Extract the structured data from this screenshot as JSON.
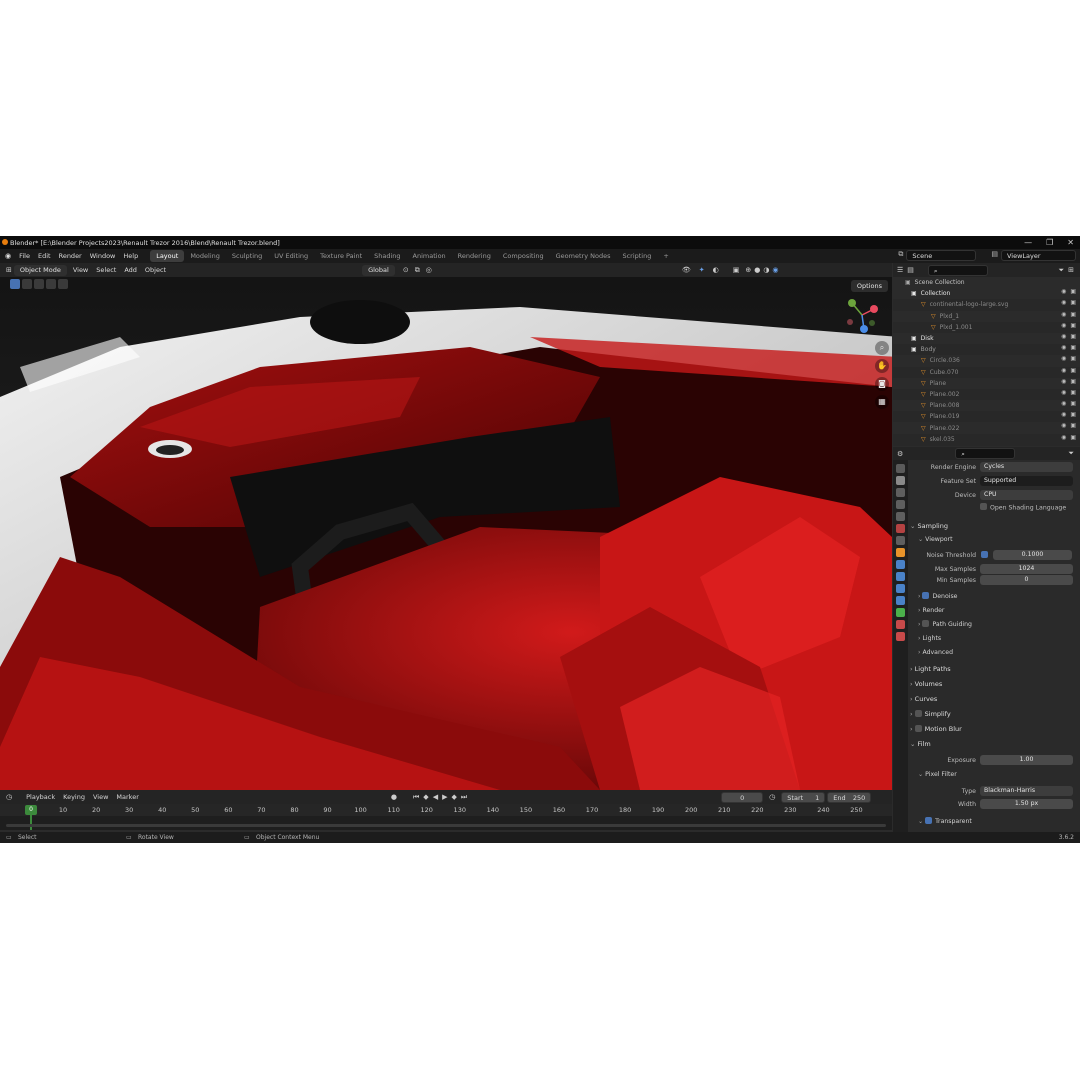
{
  "window": {
    "title": "Blender* [E:\\Blender Projects2023\\Renault Trezor 2016\\Blend\\Renault Trezor.blend]",
    "controls": [
      "—",
      "❐",
      "✕"
    ]
  },
  "menubar": {
    "menus": [
      "File",
      "Edit",
      "Render",
      "Window",
      "Help"
    ],
    "workspaces": [
      "Layout",
      "Modeling",
      "Sculpting",
      "UV Editing",
      "Texture Paint",
      "Shading",
      "Animation",
      "Rendering",
      "Compositing",
      "Geometry Nodes",
      "Scripting"
    ],
    "add_workspace": "+",
    "scene": "Scene",
    "view_layer": "ViewLayer"
  },
  "viewport_header": {
    "mode": "Object Mode",
    "menus": [
      "View",
      "Select",
      "Add",
      "Object"
    ],
    "orientation": "Global",
    "options": "Options"
  },
  "outliner": {
    "root": "Scene Collection",
    "rows": [
      {
        "name": "Collection",
        "indent": 1,
        "color": "#e6e6e6"
      },
      {
        "name": "continental-logo-large.svg",
        "indent": 2,
        "color": "#8a8a8a"
      },
      {
        "name": "Plxd_1",
        "indent": 3,
        "color": "#8a8a8a"
      },
      {
        "name": "Plxd_1.001",
        "indent": 3,
        "color": "#8a8a8a"
      },
      {
        "name": "Disk",
        "indent": 1,
        "color": "#e6e6e6"
      },
      {
        "name": "Body",
        "indent": 1,
        "color": "#9a9a9a"
      },
      {
        "name": "Circle.036",
        "indent": 2,
        "color": "#8a8a8a"
      },
      {
        "name": "Cube.070",
        "indent": 2,
        "color": "#8a8a8a"
      },
      {
        "name": "Plane",
        "indent": 2,
        "color": "#8a8a8a"
      },
      {
        "name": "Plane.002",
        "indent": 2,
        "color": "#8a8a8a"
      },
      {
        "name": "Plane.008",
        "indent": 2,
        "color": "#8a8a8a"
      },
      {
        "name": "Plane.019",
        "indent": 2,
        "color": "#8a8a8a"
      },
      {
        "name": "Plane.022",
        "indent": 2,
        "color": "#8a8a8a"
      },
      {
        "name": "skel.035",
        "indent": 2,
        "color": "#8a8a8a"
      }
    ]
  },
  "properties": {
    "render_engine_label": "Render Engine",
    "render_engine": "Cycles",
    "feature_set_label": "Feature Set",
    "feature_set": "Supported",
    "device_label": "Device",
    "device": "CPU",
    "osl": "Open Shading Language",
    "sampling": "Sampling",
    "viewport": "Viewport",
    "noise_threshold_label": "Noise Threshold",
    "noise_threshold": "0.1000",
    "max_samples_label": "Max Samples",
    "max_samples": "1024",
    "min_samples_label": "Min Samples",
    "min_samples": "0",
    "denoise": "Denoise",
    "render": "Render",
    "path_guiding": "Path Guiding",
    "lights": "Lights",
    "advanced": "Advanced",
    "light_paths": "Light Paths",
    "volumes": "Volumes",
    "curves": "Curves",
    "simplify": "Simplify",
    "motion_blur": "Motion Blur",
    "film": "Film",
    "exposure_label": "Exposure",
    "exposure": "1.00",
    "pixel_filter": "Pixel Filter",
    "type_label": "Type",
    "type": "Blackman-Harris",
    "width_label": "Width",
    "width": "1.50 px",
    "transparent": "Transparent"
  },
  "timeline": {
    "menus": [
      "Playback",
      "Keying",
      "View",
      "Marker"
    ],
    "current_frame": "0",
    "start_label": "Start",
    "start": "1",
    "end_label": "End",
    "end": "250",
    "frame_marks": [
      "0",
      "10",
      "20",
      "30",
      "40",
      "50",
      "60",
      "70",
      "80",
      "90",
      "100",
      "110",
      "120",
      "130",
      "140",
      "150",
      "160",
      "170",
      "180",
      "190",
      "200",
      "210",
      "220",
      "230",
      "240",
      "250"
    ]
  },
  "statusbar": {
    "select": "Select",
    "rotate": "Rotate View",
    "context": "Object Context Menu",
    "version": "3.6.2"
  }
}
